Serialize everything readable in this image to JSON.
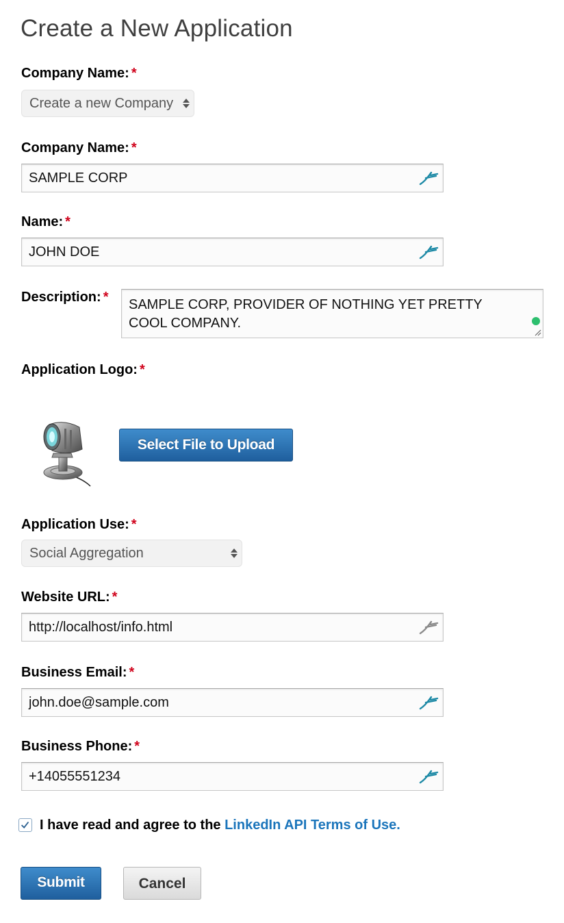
{
  "page": {
    "title": "Create a New Application"
  },
  "form": {
    "required_marker": "*",
    "company_select": {
      "label": "Company Name:",
      "value": "Create a new Company"
    },
    "company_name": {
      "label": "Company Name:",
      "value": "SAMPLE CORP",
      "icon": "autofill-icon"
    },
    "name": {
      "label": "Name:",
      "value": "JOHN DOE",
      "icon": "autofill-icon"
    },
    "description": {
      "label": "Description:",
      "value": "SAMPLE CORP, PROVIDER OF NOTHING YET PRETTY COOL COMPANY."
    },
    "logo": {
      "label": "Application Logo:",
      "upload_button": "Select File to Upload"
    },
    "application_use": {
      "label": "Application Use:",
      "value": "Social Aggregation"
    },
    "website_url": {
      "label": "Website URL:",
      "value": "http://localhost/info.html"
    },
    "business_email": {
      "label": "Business Email:",
      "value": "john.doe@sample.com"
    },
    "business_phone": {
      "label": "Business Phone:",
      "value": "+14055551234"
    },
    "terms": {
      "checked": true,
      "text": "I have read and agree to the ",
      "link": "LinkedIn API Terms of Use."
    },
    "submit_label": "Submit",
    "cancel_label": "Cancel"
  },
  "colors": {
    "required": "#d0021b",
    "link": "#1b75bb",
    "primary_button": "#2a6db0",
    "autofill_icon": "#1e8aa6"
  }
}
